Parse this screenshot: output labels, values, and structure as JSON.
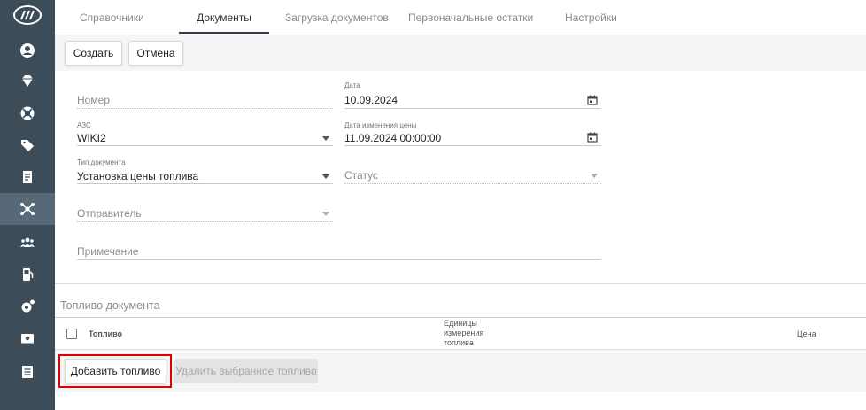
{
  "tabs": [
    {
      "label": "Справочники"
    },
    {
      "label": "Документы",
      "active": true
    },
    {
      "label": "Загрузка документов"
    },
    {
      "label": "Первоначальные остатки"
    },
    {
      "label": "Настройки"
    }
  ],
  "toolbar": {
    "create_label": "Создать",
    "cancel_label": "Отмена"
  },
  "form": {
    "number": {
      "placeholder": "Номер",
      "value": ""
    },
    "date": {
      "label": "Дата",
      "value": "10.09.2024"
    },
    "azs": {
      "label": "АЗС",
      "value": "WIKI2"
    },
    "price_change_date": {
      "label": "Дата изменения цены",
      "value": "11.09.2024 00:00:00"
    },
    "doc_type": {
      "label": "Тип документа",
      "value": "Установка цены топлива"
    },
    "status": {
      "placeholder": "Статус",
      "value": ""
    },
    "sender": {
      "placeholder": "Отправитель",
      "value": ""
    },
    "note": {
      "placeholder": "Примечание",
      "value": ""
    }
  },
  "fuel_section": {
    "title": "Топливо документа",
    "columns": {
      "fuel": "Топливо",
      "unit_line1": "Единицы",
      "unit_line2": "измерения",
      "unit_line3": "топлива",
      "price": "Цена"
    },
    "add_label": "Добавить топливо",
    "delete_label": "Удалить выбранное топливо"
  },
  "sidebar": {
    "icons": [
      "logo-icon",
      "account-icon",
      "diamond-icon",
      "lifebuoy-icon",
      "tag-icon",
      "document-icon",
      "network-icon",
      "users-icon",
      "fuel-pump-icon",
      "settings-icon",
      "payment-icon",
      "list-icon"
    ],
    "active": "network-icon"
  },
  "colors": {
    "sidebar": "#3d4c59",
    "sidebar_active": "#576878",
    "highlight": "#e00000"
  }
}
